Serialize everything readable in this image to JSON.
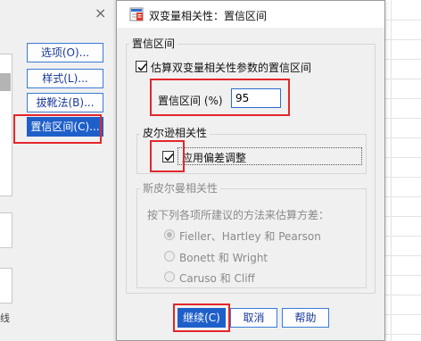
{
  "parent_window": {
    "close_glyph": "×",
    "buttons": [
      "选项(O)...",
      "样式(L)...",
      "拔靴法(B)...",
      "置信区间(C)..."
    ],
    "edge_char": "线"
  },
  "dialog": {
    "title": "双变量相关性：置信区间",
    "main_group_title": "置信区间",
    "estimate_checkbox_label": "估算双变量相关性参数的置信区间",
    "estimate_checked": true,
    "ci_label": "置信区间 (%)",
    "ci_value": "95",
    "pearson_group_title": "皮尔逊相关性",
    "bias_checkbox_label": "应用偏差调整",
    "bias_checked": true,
    "spearman_group_title": "斯皮尔曼相关性",
    "spearman_prompt": "按下列各项所建议的方法来估算方差：",
    "spearman_options": [
      "Fieller、Hartley 和 Pearson",
      "Bonett 和 Wright",
      "Caruso 和 Cliff"
    ],
    "spearman_selected": 0,
    "footer_buttons": {
      "continue": "继续(C)",
      "cancel": "取消",
      "help": "帮助"
    }
  },
  "colors": {
    "accent": "#1f5fc9",
    "highlight": "#e3262b"
  }
}
